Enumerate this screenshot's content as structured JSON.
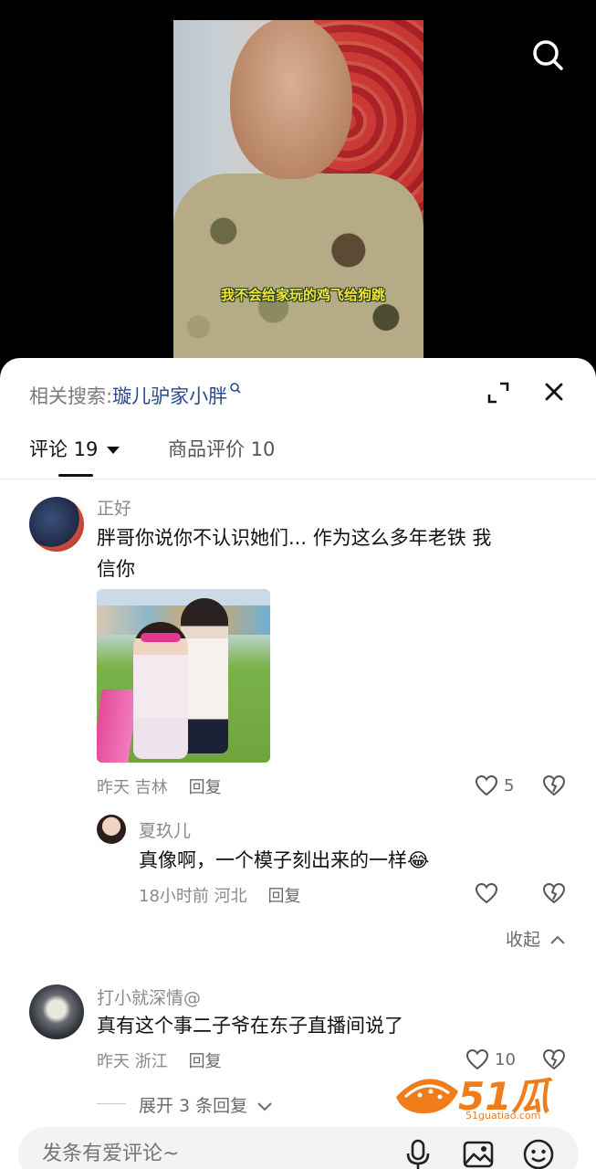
{
  "video": {
    "caption": "我不会给家玩的鸡飞给狗跳"
  },
  "panel": {
    "related_label": "相关搜索:",
    "related_query": "璇儿驴家小胖",
    "tabs": [
      {
        "label": "评论 19"
      },
      {
        "label": "商品评价 10"
      }
    ]
  },
  "comments": [
    {
      "user": "正好",
      "text_line1": "胖哥你说你不认识她们... 作为这么多年老铁 我",
      "text_line2": "信你",
      "time": "昨天",
      "location": "吉林",
      "reply_label": "回复",
      "likes": "5",
      "replies": [
        {
          "user": "夏玖儿",
          "text": "真像啊，一个模子刻出来的一样",
          "emoji": "😂",
          "time": "18小时前",
          "location": "河北",
          "reply_label": "回复",
          "likes": ""
        }
      ],
      "collapse_label": "收起"
    },
    {
      "user": "打小就深情@",
      "text": "真有这个事二子爷在东子直播间说了",
      "time": "昨天",
      "location": "浙江",
      "reply_label": "回复",
      "likes": "10",
      "more_replies": "展开 3 条回复"
    }
  ],
  "watermark": {
    "brand": "51瓜条",
    "url": "51guatiao.com"
  },
  "input": {
    "placeholder": "发条有爱评论~"
  },
  "colors": {
    "panel_bg": "#ffffff",
    "link": "#2a4a8a",
    "caption_yellow": "#f4e43a",
    "watermark_orange": "#f07d19"
  }
}
